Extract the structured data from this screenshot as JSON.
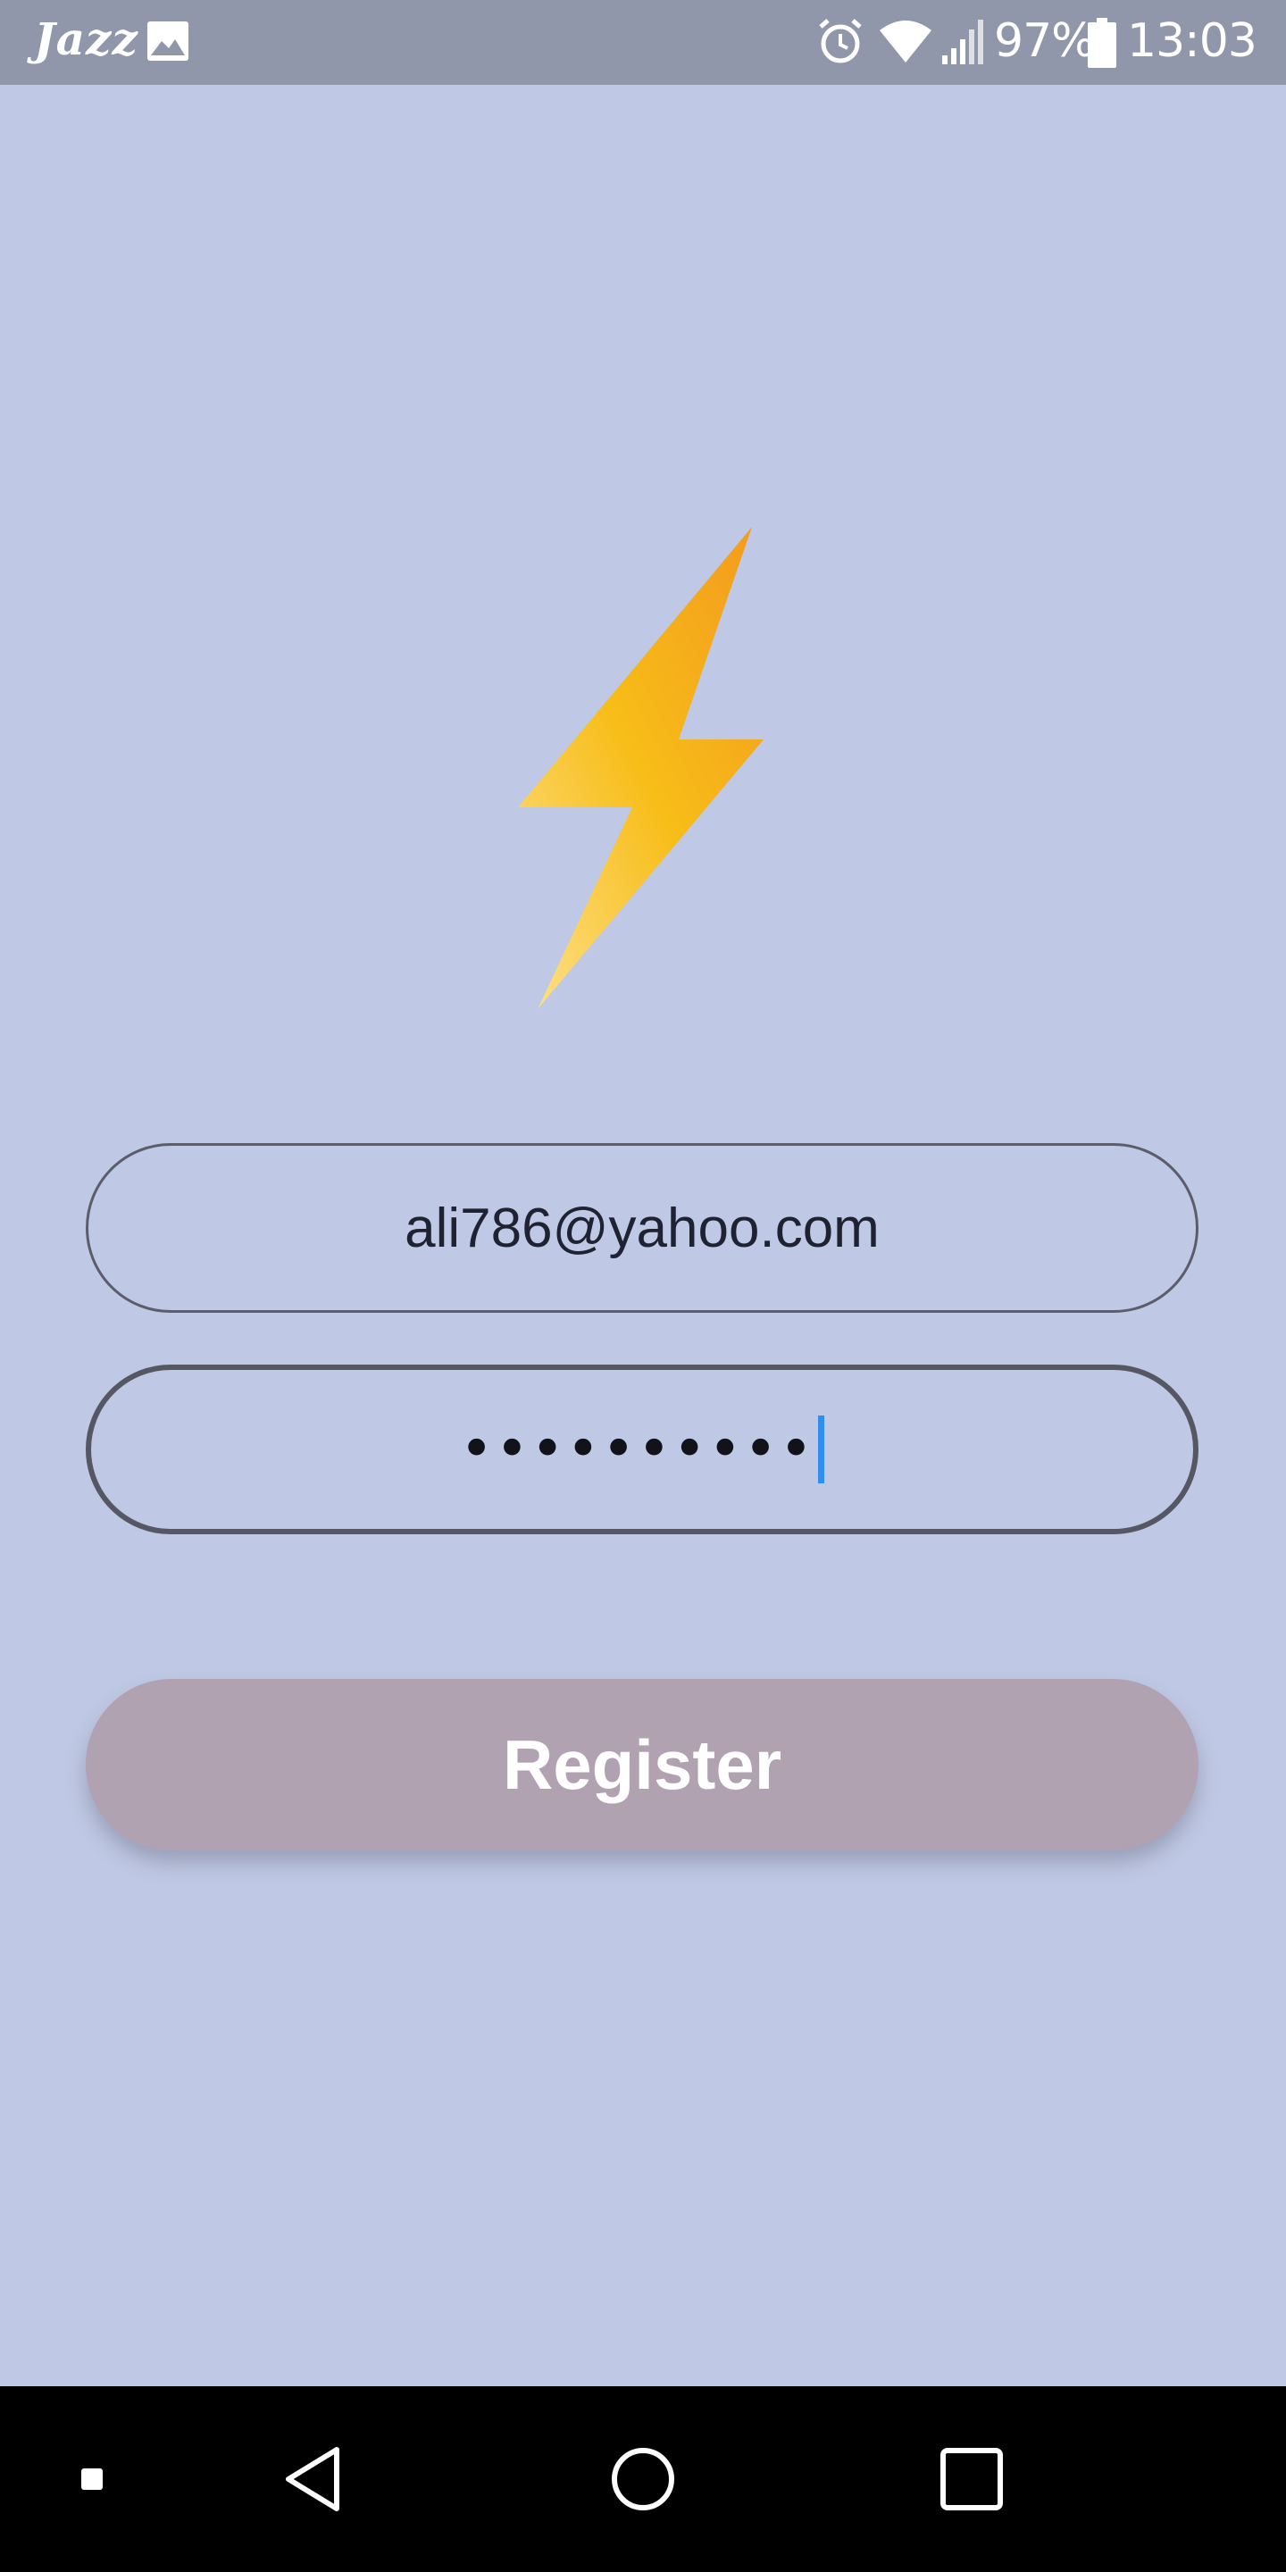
{
  "status_bar": {
    "carrier": "Jazz",
    "battery_percent": "97%",
    "time": "13:03",
    "icons": [
      "image-icon",
      "alarm-icon",
      "wifi-icon",
      "signal-icon",
      "battery-icon"
    ]
  },
  "logo": {
    "icon": "lightning-bolt-icon",
    "colors": {
      "top": "#f4a21c",
      "middle": "#f7bd1a",
      "bottom": "#fdd87a"
    }
  },
  "form": {
    "email_value": "ali786@yahoo.com",
    "password_mask": "••••••••••",
    "register_label": "Register"
  },
  "nav_bar": {
    "icons": [
      "menu-square-icon",
      "back-icon",
      "home-icon",
      "recents-icon"
    ]
  },
  "colors": {
    "background": "#bfc8e4",
    "status_bar": "#9197ab",
    "button": "#b1a2b1",
    "caret": "#2f8ef0"
  }
}
